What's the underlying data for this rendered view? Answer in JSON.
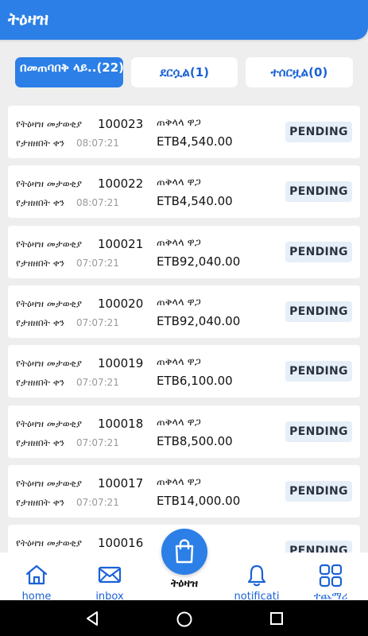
{
  "header": {
    "title": "ትዕዛዝ"
  },
  "tabs": [
    {
      "label": "በመጠባበቅ ላይ..(22)"
    },
    {
      "label": "ደርሷል(1)"
    },
    {
      "label": "ተሰርዟል(0)"
    }
  ],
  "orders": [
    {
      "order_id_label": "የትዕዛዝ መታወቂያ",
      "order_id": "100023",
      "date_label": "የታዘዘበት ቀን",
      "time": "08:07:21",
      "total_label": "ጠቅላላ ዋጋ",
      "total": "ETB4,540.00",
      "status": "PENDING"
    },
    {
      "order_id_label": "የትዕዛዝ መታወቂያ",
      "order_id": "100022",
      "date_label": "የታዘዘበት ቀን",
      "time": "08:07:21",
      "total_label": "ጠቅላላ ዋጋ",
      "total": "ETB4,540.00",
      "status": "PENDING"
    },
    {
      "order_id_label": "የትዕዛዝ መታወቂያ",
      "order_id": "100021",
      "date_label": "የታዘዘበት ቀን",
      "time": "07:07:21",
      "total_label": "ጠቅላላ ዋጋ",
      "total": "ETB92,040.00",
      "status": "PENDING"
    },
    {
      "order_id_label": "የትዕዛዝ መታወቂያ",
      "order_id": "100020",
      "date_label": "የታዘዘበት ቀን",
      "time": "07:07:21",
      "total_label": "ጠቅላላ ዋጋ",
      "total": "ETB92,040.00",
      "status": "PENDING"
    },
    {
      "order_id_label": "የትዕዛዝ መታወቂያ",
      "order_id": "100019",
      "date_label": "የታዘዘበት ቀን",
      "time": "07:07:21",
      "total_label": "ጠቅላላ ዋጋ",
      "total": "ETB6,100.00",
      "status": "PENDING"
    },
    {
      "order_id_label": "የትዕዛዝ መታወቂያ",
      "order_id": "100018",
      "date_label": "የታዘዘበት ቀን",
      "time": "07:07:21",
      "total_label": "ጠቅላላ ዋጋ",
      "total": "ETB8,500.00",
      "status": "PENDING"
    },
    {
      "order_id_label": "የትዕዛዝ መታወቂያ",
      "order_id": "100017",
      "date_label": "የታዘዘበት ቀን",
      "time": "07:07:21",
      "total_label": "ጠቅላላ ዋጋ",
      "total": "ETB14,000.00",
      "status": "PENDING"
    },
    {
      "order_id_label": "የትዕዛዝ መታወቂያ",
      "order_id": "100016",
      "date_label": "",
      "time": "",
      "total_label": "",
      "total": "",
      "status": "PENDING"
    }
  ],
  "bottom_nav": {
    "home": {
      "label": "home",
      "icon": "home-icon"
    },
    "inbox": {
      "label": "inbox",
      "icon": "mail-icon"
    },
    "orders": {
      "label": "ትዕዛዝ",
      "icon": "shopping-bag-icon"
    },
    "notifications": {
      "label": "notificati",
      "icon": "bell-icon"
    },
    "more": {
      "label": "ተጨማሪ",
      "icon": "grid-icon"
    }
  },
  "colors": {
    "primary": "#2b7fe6",
    "badge_bg": "#e6eef8",
    "background": "#eeeeee"
  }
}
